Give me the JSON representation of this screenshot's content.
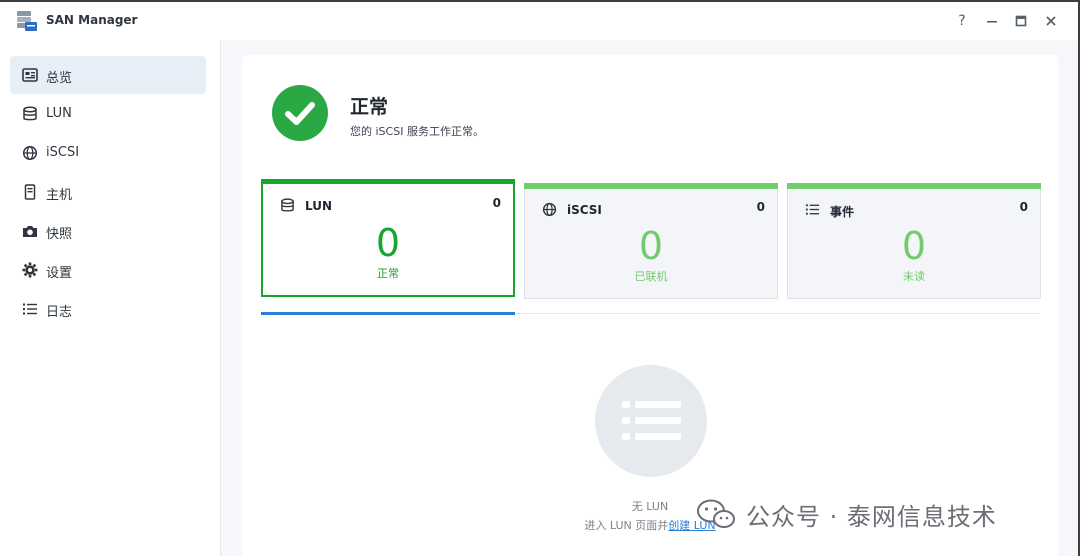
{
  "window": {
    "title": "SAN Manager"
  },
  "controls": {
    "help": "?",
    "minimize": "−",
    "maximize": "□",
    "close": "✕"
  },
  "sidebar": {
    "items": [
      {
        "label": "总览",
        "icon": "overview-icon"
      },
      {
        "label": "LUN",
        "icon": "database-icon"
      },
      {
        "label": "iSCSI",
        "icon": "globe-icon"
      },
      {
        "label": "主机",
        "icon": "host-icon"
      },
      {
        "label": "快照",
        "icon": "camera-icon"
      },
      {
        "label": "设置",
        "icon": "gear-icon"
      },
      {
        "label": "日志",
        "icon": "list-icon"
      }
    ],
    "active_index": 0
  },
  "status": {
    "title": "正常",
    "description": "您的 iSCSI 服务工作正常。"
  },
  "cards": [
    {
      "name": "LUN",
      "count": "0",
      "big": "0",
      "sub": "正常",
      "icon": "database-icon"
    },
    {
      "name": "iSCSI",
      "count": "0",
      "big": "0",
      "sub": "已联机",
      "icon": "globe-icon"
    },
    {
      "name": "事件",
      "count": "0",
      "big": "0",
      "sub": "未读",
      "icon": "list-icon"
    }
  ],
  "empty": {
    "title": "无 LUN",
    "prefix": "进入 LUN 页面并",
    "link": "创建 LUN"
  },
  "watermark": {
    "text": "公众号 · 泰网信息技术"
  },
  "colors": {
    "accent_green": "#18a62f",
    "light_green": "#71cc6b",
    "tab_blue": "#2a7fd6",
    "active_nav": "#e6eef8"
  }
}
